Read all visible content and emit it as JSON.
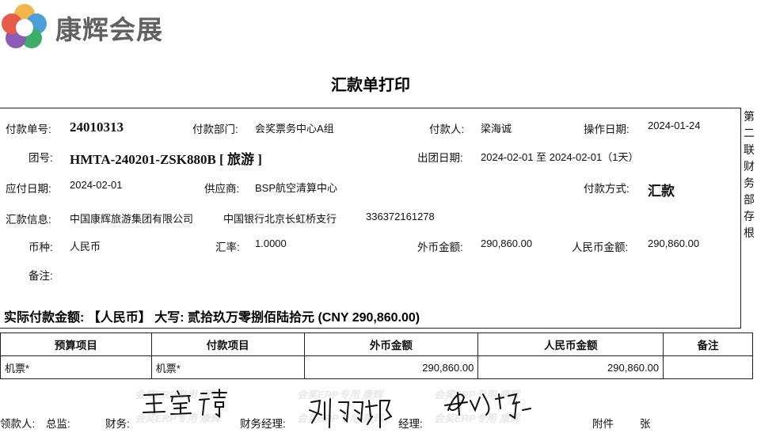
{
  "logo": {
    "text": "康辉会展"
  },
  "doc": {
    "title": "汇款单打印"
  },
  "side_note": [
    "第",
    "二",
    "联",
    "财",
    "务",
    "部",
    "存",
    "根"
  ],
  "row1": {
    "pay_no_label": "付款单号:",
    "pay_no": "24010313",
    "dept_label": "付款部门:",
    "dept": "会奖票务中心A组",
    "payer_label": "付款人:",
    "payer": "梁海诚",
    "op_date_label": "操作日期:",
    "op_date": "2024-01-24"
  },
  "row2": {
    "group_label": "团号:",
    "group": "HMTA-240201-ZSK880B [ 旅游 ]",
    "tour_date_label": "出团日期:",
    "tour_date": "2024-02-01 至 2024-02-01（1天）"
  },
  "row3": {
    "due_label": "应付日期:",
    "due": "2024-02-01",
    "supplier_label": "供应商:",
    "supplier": "BSP航空清算中心",
    "method_label": "付款方式:",
    "method": "汇款"
  },
  "row4": {
    "remit_label": "汇款信息:",
    "company": "中国康辉旅游集团有限公司",
    "bank": "中国银行北京长虹桥支行",
    "account": "336372161278"
  },
  "row5": {
    "currency_label": "币种:",
    "currency": "人民币",
    "rate_label": "汇率:",
    "rate": "1.0000",
    "fx_label": "外币金额:",
    "fx": "290,860.00",
    "rmb_label": "人民币金额:",
    "rmb": "290,860.00"
  },
  "row6": {
    "note_label": "备注:",
    "note": ""
  },
  "actual": {
    "text": "实际付款金额: 【人民币】 大写: 贰拾玖万零捌佰陆拾元 (CNY 290,860.00)"
  },
  "table": {
    "headers": [
      "预算项目",
      "付款项目",
      "外币金额",
      "人民币金额",
      "备注"
    ],
    "rows": [
      {
        "budget": "机票*",
        "item": "机票*",
        "fx": "290,860.00",
        "rmb": "290,860.00",
        "note": ""
      }
    ]
  },
  "footer": {
    "receiver": "领款人:",
    "director": "总监:",
    "finance": "财务:",
    "fin_manager": "财务经理:",
    "manager": "经理:",
    "attach": "附件",
    "unit": "张"
  },
  "watermark": {
    "text": "会奖ERP专用 康辉"
  },
  "colors": {
    "logo_text": "#616161",
    "border": "#222222"
  }
}
